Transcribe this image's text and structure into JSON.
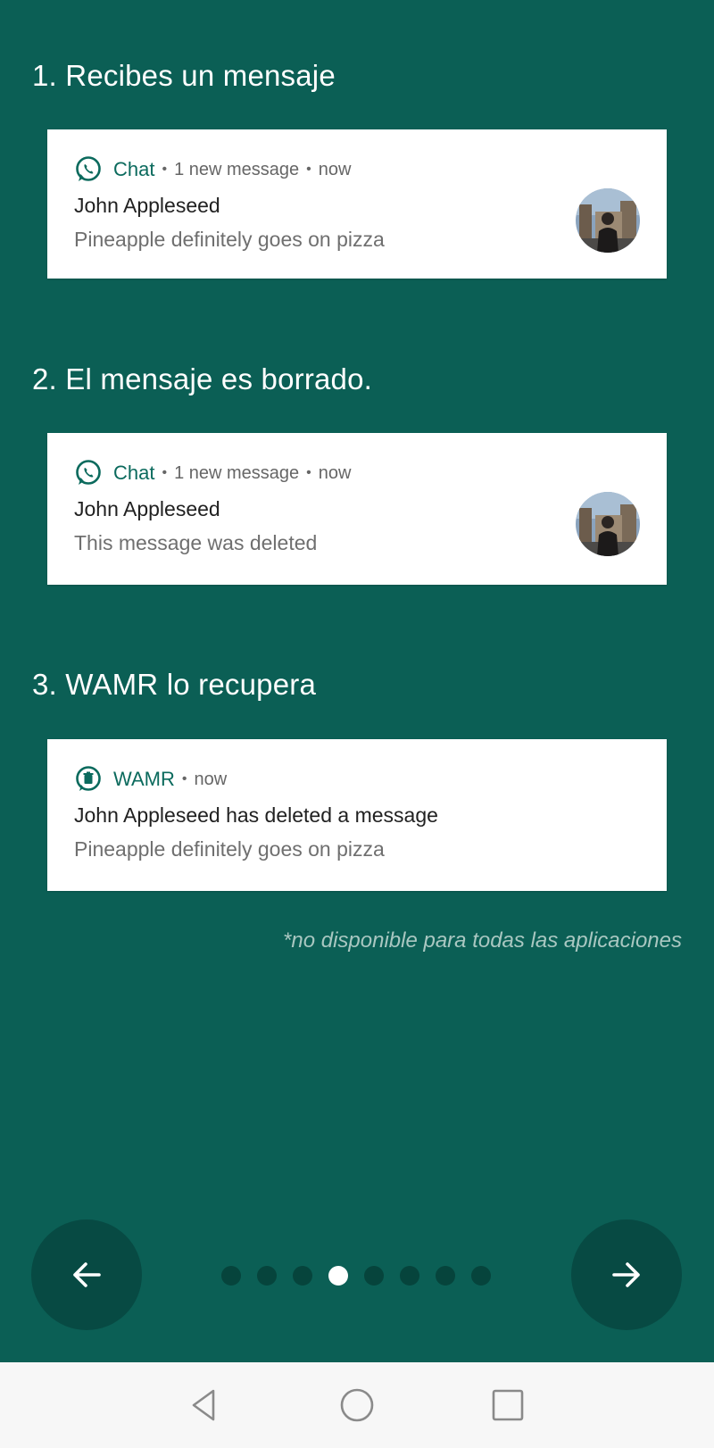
{
  "steps": [
    {
      "title": "1. Recibes un mensaje",
      "notification": {
        "app_name": "Chat",
        "app_icon": "whatsapp-icon",
        "meta_parts": [
          "1 new message",
          "now"
        ],
        "title": "John Appleseed",
        "text": "Pineapple definitely goes on pizza",
        "has_avatar": true
      }
    },
    {
      "title": "2. El mensaje es borrado.",
      "notification": {
        "app_name": "Chat",
        "app_icon": "whatsapp-icon",
        "meta_parts": [
          "1 new message",
          "now"
        ],
        "title": "John Appleseed",
        "text": "This message was deleted",
        "has_avatar": true
      }
    },
    {
      "title": "3. WAMR lo recupera",
      "notification": {
        "app_name": "WAMR",
        "app_icon": "wamr-icon",
        "meta_parts": [
          "now"
        ],
        "title": "John Appleseed has deleted a message",
        "text": "Pineapple definitely goes on pizza",
        "has_avatar": false
      }
    }
  ],
  "disclaimer": "*no disponible para todas las aplicaciones",
  "pager": {
    "total": 8,
    "current_index": 3
  },
  "navigation": {
    "prev_icon": "arrow-left-icon",
    "next_icon": "arrow-right-icon"
  },
  "system_nav": {
    "back_icon": "triangle-back-icon",
    "home_icon": "circle-home-icon",
    "recents_icon": "square-recents-icon"
  },
  "colors": {
    "background": "#0b5f55",
    "button": "#074a43",
    "accent": "#0b6a5d",
    "pager_inactive": "#06443c",
    "pager_active": "#ffffff",
    "disclaimer": "#a9c7c1"
  }
}
